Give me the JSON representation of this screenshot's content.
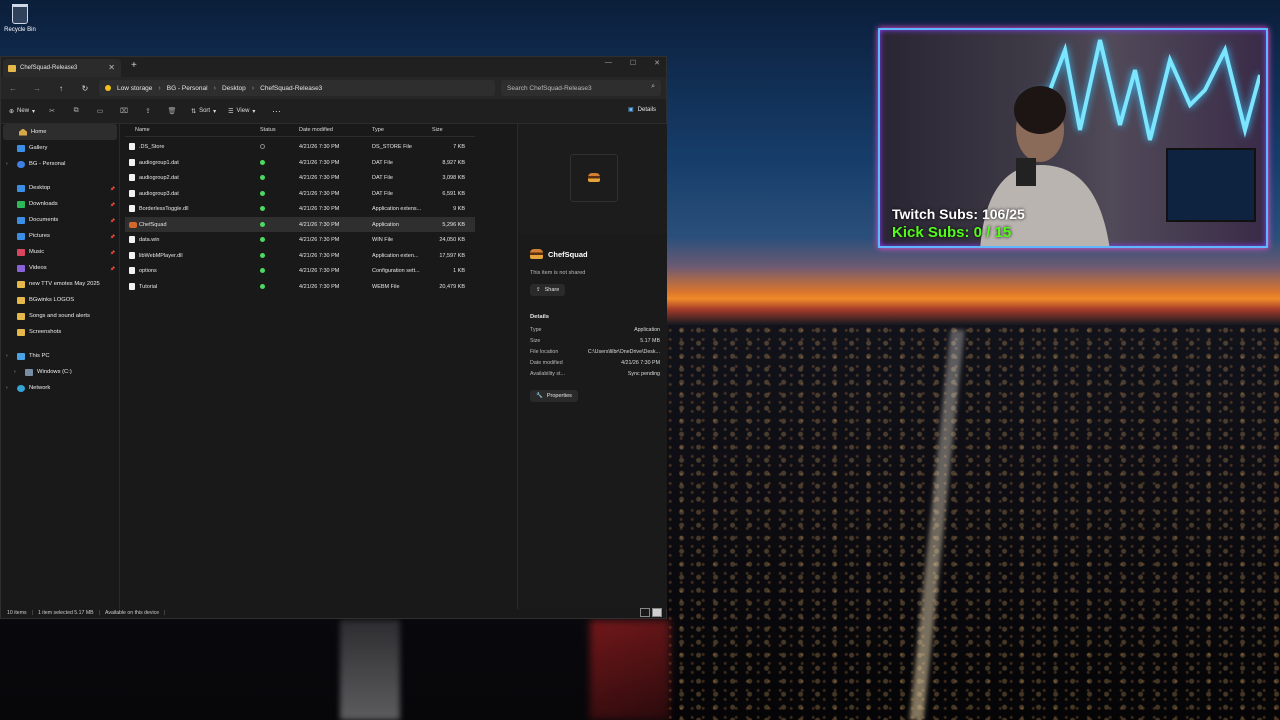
{
  "desktop": {
    "recycle_label": "Recycle Bin"
  },
  "overlay": {
    "twitch": "Twitch Subs: 106/25",
    "kick": "Kick Subs: 0 / 15",
    "kick_color": "#53fc18",
    "frame_color": "#5fb7ff"
  },
  "window": {
    "tab_title": "ChefSquad-Release3",
    "breadcrumb": [
      "Low storage",
      "BG - Personal",
      "Desktop",
      "ChefSquad-Release3"
    ],
    "search_placeholder": "Search ChefSquad-Release3",
    "toolbar": {
      "new": "New",
      "sort": "Sort",
      "view": "View",
      "details": "Details"
    },
    "sidebar": [
      {
        "label": "Home",
        "icon": "home-icon",
        "selected": true
      },
      {
        "label": "Gallery",
        "icon": "gallery-icon"
      },
      {
        "label": "BG - Personal",
        "icon": "cloud-icon"
      },
      {
        "label": "Desktop",
        "icon": "desktop-icon",
        "pinned": true
      },
      {
        "label": "Downloads",
        "icon": "downloads-icon",
        "pinned": true
      },
      {
        "label": "Documents",
        "icon": "documents-icon",
        "pinned": true
      },
      {
        "label": "Pictures",
        "icon": "pictures-icon",
        "pinned": true
      },
      {
        "label": "Music",
        "icon": "music-icon",
        "pinned": true
      },
      {
        "label": "Videos",
        "icon": "videos-icon",
        "pinned": true
      },
      {
        "label": "new TTV emotes May 2025",
        "icon": "folder-icon"
      },
      {
        "label": "BGwinks LOGOS",
        "icon": "folder-icon"
      },
      {
        "label": "Songs and sound alerts",
        "icon": "folder-icon"
      },
      {
        "label": "Screenshots",
        "icon": "folder-icon"
      },
      {
        "label": "This PC",
        "icon": "pc-icon"
      },
      {
        "label": "Windows (C:)",
        "icon": "drive-icon"
      },
      {
        "label": "Network",
        "icon": "network-icon"
      }
    ],
    "columns": [
      "Name",
      "Status",
      "Date modified",
      "Type",
      "Size"
    ],
    "files": [
      {
        "name": ".DS_Store",
        "status": "sync",
        "date": "4/21/26 7:30 PM",
        "type": "DS_STORE File",
        "size": "7 KB"
      },
      {
        "name": "audiogroup1.dat",
        "status": "ok",
        "date": "4/21/26 7:30 PM",
        "type": "DAT File",
        "size": "8,927 KB"
      },
      {
        "name": "audiogroup2.dat",
        "status": "ok",
        "date": "4/21/26 7:30 PM",
        "type": "DAT File",
        "size": "3,098 KB"
      },
      {
        "name": "audiogroup3.dat",
        "status": "ok",
        "date": "4/21/26 7:30 PM",
        "type": "DAT File",
        "size": "6,591 KB"
      },
      {
        "name": "BorderlessToggle.dll",
        "status": "ok",
        "date": "4/21/26 7:30 PM",
        "type": "Application extens...",
        "size": "9 KB"
      },
      {
        "name": "ChefSquad",
        "status": "ok",
        "date": "4/21/26 7:30 PM",
        "type": "Application",
        "size": "5,296 KB",
        "selected": true,
        "app": true
      },
      {
        "name": "data.win",
        "status": "ok",
        "date": "4/21/26 7:30 PM",
        "type": "WIN File",
        "size": "24,050 KB"
      },
      {
        "name": "libWebMPlayer.dll",
        "status": "ok",
        "date": "4/21/26 7:30 PM",
        "type": "Application exten...",
        "size": "17,597 KB"
      },
      {
        "name": "options",
        "status": "ok",
        "date": "4/21/26 7:30 PM",
        "type": "Configuration sett...",
        "size": "1 KB"
      },
      {
        "name": "Tutorial",
        "status": "ok",
        "date": "4/21/26 7:30 PM",
        "type": "WEBM File",
        "size": "20,479 KB"
      }
    ],
    "preview": {
      "name": "ChefSquad",
      "share_note": "This item is not shared",
      "share_label": "Share",
      "details_heading": "Details",
      "props": [
        {
          "k": "Type",
          "v": "Application"
        },
        {
          "k": "Size",
          "v": "5.17 MB"
        },
        {
          "k": "File location",
          "v": "C:\\Users\\lilbr\\OneDrive\\Desk..."
        },
        {
          "k": "Date modified",
          "v": "4/21/26 7:30 PM"
        },
        {
          "k": "Availability st...",
          "v": "Sync pending"
        }
      ],
      "properties_label": "Properties"
    },
    "status": [
      "10 items",
      "1 item selected  5.17 MB",
      "Available on this device"
    ]
  }
}
